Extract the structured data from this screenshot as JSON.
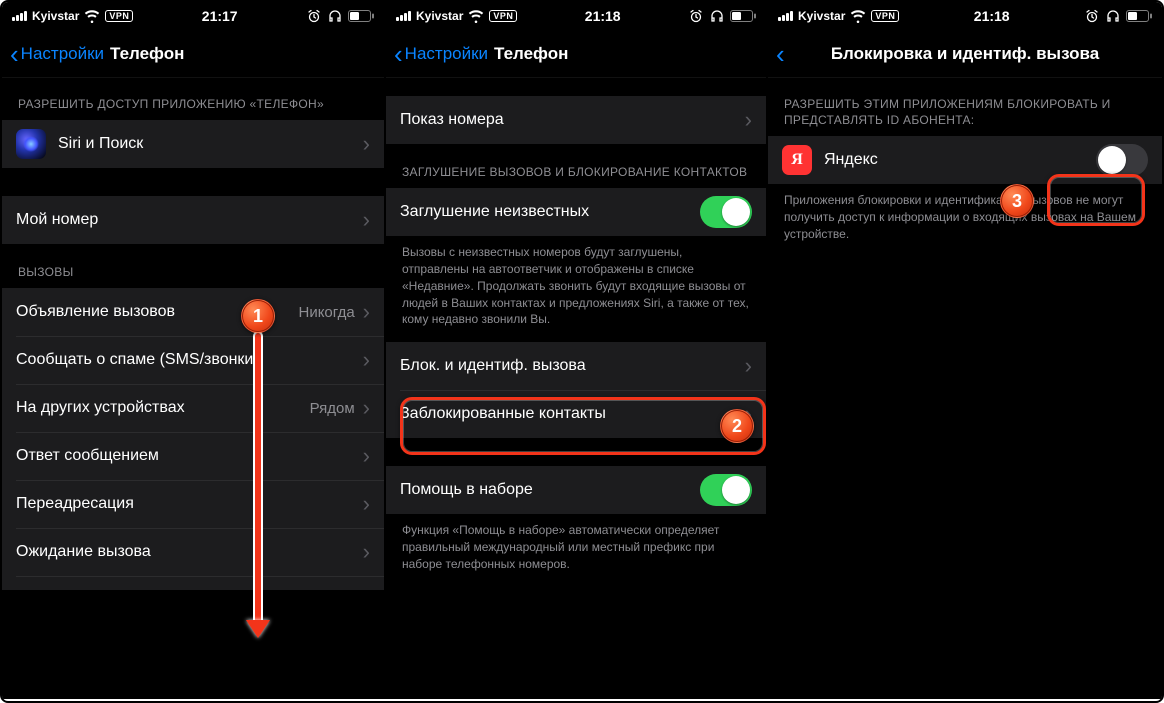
{
  "status": {
    "carrier": "Kyivstar",
    "vpn": "VPN"
  },
  "s1": {
    "time": "21:17",
    "back": "Настройки",
    "title": "Телефон",
    "sec_access": "РАЗРЕШИТЬ ДОСТУП ПРИЛОЖЕНИЮ «ТЕЛЕФОН»",
    "siri": "Siri и Поиск",
    "mynum": "Мой номер",
    "sec_calls": "ВЫЗОВЫ",
    "announce": "Объявление вызовов",
    "announce_val": "Никогда",
    "spam": "Сообщать о спаме (SMS/звонки)",
    "otherdev": "На других устройствах",
    "otherdev_val": "Рядом",
    "reply": "Ответ сообщением",
    "forward": "Переадресация",
    "wait": "Ожидание вызова"
  },
  "s2": {
    "time": "21:18",
    "back": "Настройки",
    "title": "Телефон",
    "showid": "Показ номера",
    "sec_silence": "ЗАГЛУШЕНИЕ ВЫЗОВОВ И БЛОКИРОВАНИЕ КОНТАКТОВ",
    "silence": "Заглушение неизвестных",
    "silence_footer": "Вызовы с неизвестных номеров будут заглушены, отправлены на автоответчик и отображены в списке «Недавние». Продолжать звонить будут входящие вызовы от людей в Ваших контактах и предложениях Siri, а также от тех, кому недавно звонили Вы.",
    "blockid": "Блок. и идентиф. вызова",
    "blocked": "Заблокированные контакты",
    "dialassist": "Помощь в наборе",
    "dialassist_footer": "Функция «Помощь в наборе» автоматически определяет правильный международный или местный префикс при наборе телефонных номеров."
  },
  "s3": {
    "time": "21:18",
    "title": "Блокировка и идентиф. вызова",
    "sec_apps": "РАЗРЕШИТЬ ЭТИМ ПРИЛОЖЕНИЯМ БЛОКИРОВАТЬ И ПРЕДСТАВЛЯТЬ ID АБОНЕНТА:",
    "yandex": "Яндекс",
    "yandex_letter": "Я",
    "footer": "Приложения блокировки и идентификации вызовов не могут получить доступ к информации о входящих вызовах на Вашем устройстве."
  },
  "badges": {
    "b1": "1",
    "b2": "2",
    "b3": "3"
  }
}
